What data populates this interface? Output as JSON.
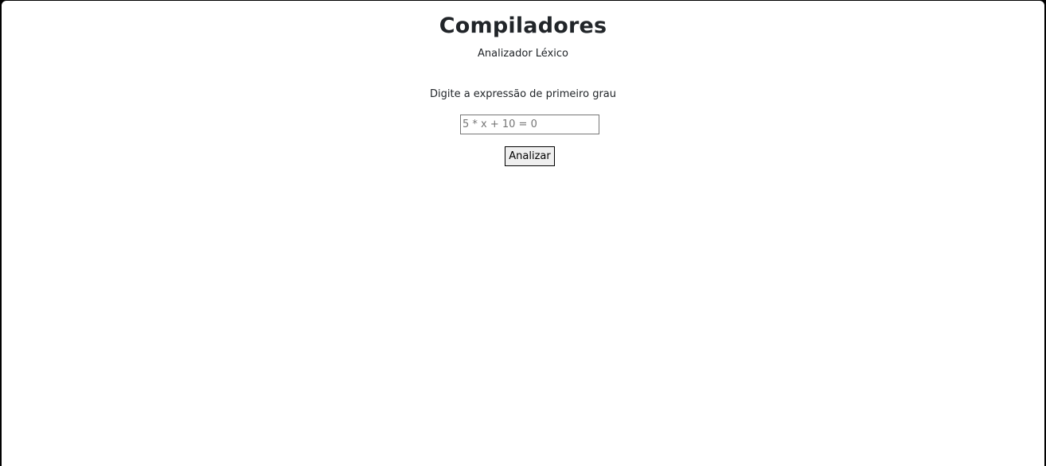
{
  "header": {
    "title": "Compiladores",
    "subtitle": "Analizador Léxico"
  },
  "form": {
    "prompt_label": "Digite a expressão de primeiro grau",
    "expression_input": {
      "value": "",
      "placeholder": "5 * x + 10 = 0"
    },
    "analyze_button_label": "Analizar"
  },
  "colors": {
    "text": "#212529",
    "background": "#ffffff",
    "frame": "#000000",
    "button_background": "#efefef",
    "input_border": "#767676"
  }
}
